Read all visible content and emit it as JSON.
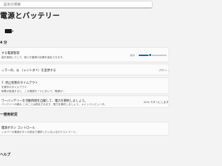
{
  "search": {
    "placeholder": "設定の検索"
  },
  "page": {
    "title": "電源とバッテリー"
  },
  "battery": {
    "estimate": "4 分"
  },
  "power_mode": {
    "title": "する電源管理",
    "subtitle": "量を使用してして、使い方重視の効果を強化させます。",
    "left_label": "ｐｐ",
    "level_percent": 42
  },
  "screen_off": {
    "title": "ィマーの、以 （ャントダイ）を変更する",
    "value": "パワー..."
  },
  "stop_timeout": {
    "title": "7. 停止状態のタイムアウト",
    "subtitle1": "を操作のタイムアウト",
    "subtitle2": "時間が経過すると、この電源モードにおいて、電源が..."
  },
  "battery_saver": {
    "title": "ワーバッテリーを活動時間を自動して、電力を節約しましょう。",
    "subtitle": "バッテリーの最大 このことは検出されます。電力を節約しましょう、メインコンピュータ。",
    "value": "20% でオンにします"
  },
  "usage": {
    "label": "ー使用状況"
  },
  "power_button": {
    "title": "電源ボタン コントロール",
    "subtitle": "ィカバーの電源ボタンの設定で選択したいない出力テストコード。"
  },
  "help": {
    "label": "ヘルプ"
  }
}
